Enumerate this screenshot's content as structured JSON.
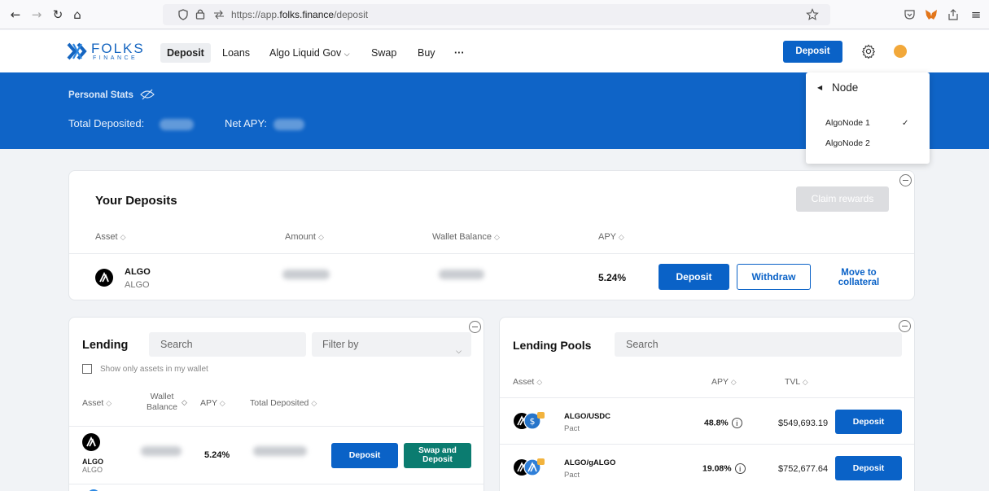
{
  "browser": {
    "url_prefix": "https://app.",
    "url_domain": "folks.finance",
    "url_path": "/deposit"
  },
  "header": {
    "logo_text": "FOLKS",
    "logo_sub": "FINANCE",
    "nav": [
      "Deposit",
      "Loans",
      "Algo Liquid Gov",
      "Swap",
      "Buy",
      "···"
    ],
    "nav_dropdown_icon": "chevron-down",
    "deposit_button": "Deposit",
    "accent": "#0a62c7"
  },
  "banner": {
    "personal_stats": "Personal Stats",
    "total_deposited_label": "Total Deposited:",
    "net_apy_label": "Net APY:",
    "background": "#0f64c7"
  },
  "node_dropdown": {
    "title": "Node",
    "options": [
      "AlgoNode 1",
      "AlgoNode 2"
    ],
    "selected": "AlgoNode 1"
  },
  "your_deposits": {
    "title": "Your Deposits",
    "claim_button": "Claim rewards",
    "columns": [
      "Asset",
      "Amount",
      "Wallet Balance",
      "APY"
    ],
    "rows": [
      {
        "asset": "ALGO",
        "asset_sub": "ALGO",
        "apy": "5.24%",
        "deposit": "Deposit",
        "withdraw": "Withdraw",
        "move": "Move to collateral"
      }
    ]
  },
  "lending": {
    "title": "Lending",
    "search_placeholder": "Search",
    "filter_placeholder": "Filter by",
    "checkbox_label": "Show only assets in my wallet",
    "columns": [
      "Asset",
      "Wallet Balance",
      "APY",
      "Total Deposited"
    ],
    "rows": [
      {
        "asset": "ALGO",
        "asset_sub": "ALGO",
        "apy": "5.24%",
        "deposit": "Deposit",
        "swap_deposit": "Swap and Deposit"
      }
    ]
  },
  "lending_pools": {
    "title": "Lending Pools",
    "search_placeholder": "Search",
    "columns": [
      "Asset",
      "APY",
      "TVL"
    ],
    "rows": [
      {
        "pair": "ALGO/USDC",
        "platform": "Pact",
        "apy": "48.8%",
        "tvl": "$549,693.19",
        "deposit": "Deposit"
      },
      {
        "pair": "ALGO/gALGO",
        "platform": "Pact",
        "apy": "19.08%",
        "tvl": "$752,677.64",
        "deposit": "Deposit"
      }
    ]
  }
}
